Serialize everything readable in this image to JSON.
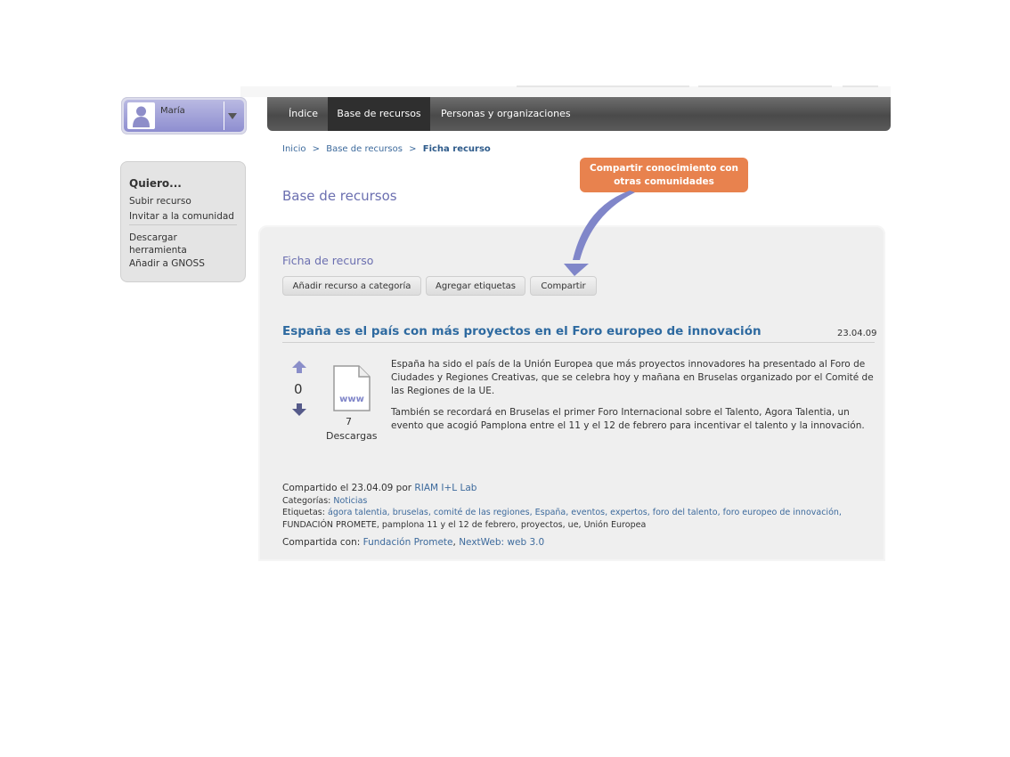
{
  "user": {
    "name": "María"
  },
  "quiero": {
    "title": "Quiero...",
    "items": [
      "Subir recurso",
      "Invitar a la comunidad",
      "Descargar herramienta",
      "Añadir a GNOSS"
    ]
  },
  "nav": {
    "items": [
      {
        "label": "Índice"
      },
      {
        "label": "Base de recursos"
      },
      {
        "label": "Personas y organizaciones"
      }
    ]
  },
  "breadcrumb": {
    "inicio": "Inicio",
    "base": "Base de recursos",
    "current": "Ficha recurso",
    "sep": ">"
  },
  "page_title": "Base de recursos",
  "ficha": {
    "title": "Ficha de recurso",
    "buttons": [
      "Añadir recurso a categoría",
      "Agregar etiquetas",
      "Compartir"
    ]
  },
  "callout": {
    "line1": "Compartir conocimiento con",
    "line2": "otras comunidades"
  },
  "resource": {
    "title": "España es el país con más proyectos en el Foro europeo de innovación",
    "date": "23.04.09",
    "votes": "0",
    "downloads": "7",
    "downloads_label": "Descargas",
    "doc_label": "www",
    "para1": "España ha sido el país de la Unión Europea que más proyectos innovadores ha presentado al Foro de Ciudades y Regiones Creativas, que se celebra hoy y mañana en Bruselas organizado por el Comité de las Regiones de la UE.",
    "para2": "También se recordará en Bruselas el primer Foro Internacional sobre el Talento, Agora Talentia, un evento que acogió Pamplona entre el 11 y el 12 de febrero para incentivar el talento y la innovación."
  },
  "meta": {
    "shared_prefix": "Compartido el 23.04.09 por",
    "shared_by": "RIAM I+L Lab",
    "categories_label": "Categorías:",
    "category": "Noticias",
    "tags_label": "Etiquetas:",
    "tags_line1": "ágora talentia, bruselas, comité de las regiones, España, eventos, expertos, foro del talento, foro europeo de innovación,",
    "tags_line2": "FUNDACIÓN PROMETE, pamplona 11 y el 12 de febrero, proyectos, ue, Unión Europea",
    "shared_with_label": "Compartida con:",
    "shared_with_1": "Fundación Promete",
    "shared_with_2": "NextWeb: web 3.0"
  },
  "colors": {
    "accent": "#6b6fb0",
    "link": "#3d6a9c",
    "callout": "#e8824e",
    "nav": "#4a4a4a"
  }
}
